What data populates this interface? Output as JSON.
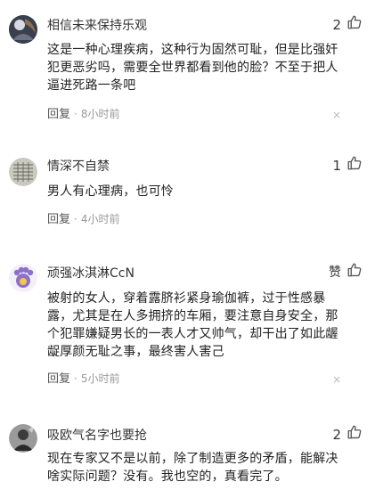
{
  "comments": [
    {
      "username": "相信未来保持乐观",
      "likes": "2",
      "content": "这是一种心理疾病，这种行为固然可耻，但是比强奸犯更恶劣吗，需要全世界都看到他的脸？不至于把人逼进死路一条吧",
      "reply_label": "回复",
      "separator": "·",
      "time": "8小时前",
      "close": "×"
    },
    {
      "username": "情深不自禁",
      "likes": "1",
      "content": "男人有心理病，也可怜",
      "reply_label": "回复",
      "separator": "·",
      "time": "4小时前",
      "close": "×"
    },
    {
      "username": "顽强冰淇淋CcN",
      "likes": "赞",
      "content": "被射的女人，穿着露脐衫紧身瑜伽裤，过于性感暴露，尤其是在人多拥挤的车厢，要注意自身安全，那个犯罪嫌疑男长的一表人才又帅气，却干出了如此龌龊厚颜无耻之事，最终害人害己",
      "reply_label": "回复",
      "separator": "·",
      "time": "5小时前",
      "close": "×"
    },
    {
      "username": "吸欧气名字也要抢",
      "likes": "2",
      "content": "现在专家又不是以前，除了制造更多的矛盾，能解决啥实际问题？没有。我也空的，真看完了。",
      "reply_label": "",
      "separator": "",
      "time": "",
      "close": ""
    }
  ],
  "colors": {
    "text": "#222222",
    "meta": "#999999",
    "background": "#ffffff"
  },
  "icons": {
    "like": "thumbs-up-icon",
    "close": "close-icon"
  }
}
